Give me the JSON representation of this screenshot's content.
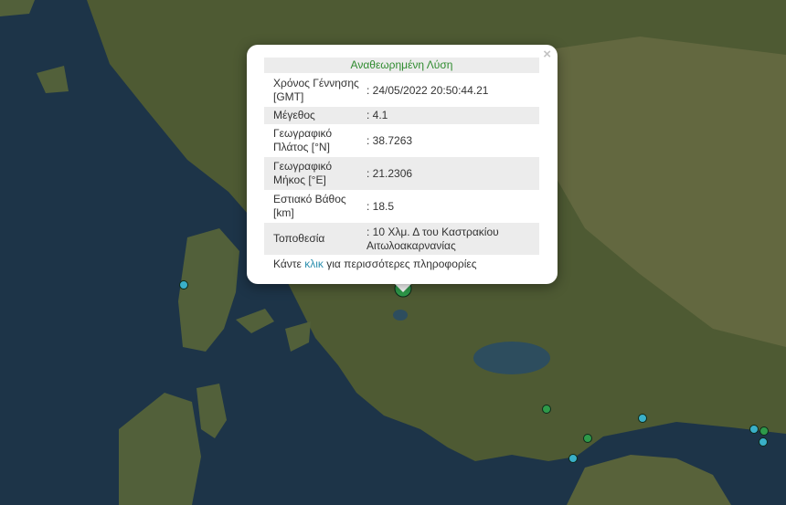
{
  "popup": {
    "close_label": "×",
    "title": "Αναθεωρημένη Λύση",
    "rows": [
      {
        "label": "Χρόνος Γέννησης [GMT]",
        "value": ": 24/05/2022 20:50:44.21"
      },
      {
        "label": "Μέγεθος",
        "value": ": 4.1"
      },
      {
        "label": "Γεωγραφικό Πλάτος [°N]",
        "value": ": 38.7263"
      },
      {
        "label": "Γεωγραφικό Μήκος [°E]",
        "value": ": 21.2306"
      },
      {
        "label": "Εστιακό Βάθος [km]",
        "value": ": 18.5"
      },
      {
        "label": "Τοποθεσία",
        "value": ": 10 Χλμ. Δ του Καστρακίου Αιτωλοακαρνανίας"
      }
    ],
    "footer_before": "Κάντε ",
    "footer_link": "κλικ",
    "footer_after": " για περισσότερες πληροφορίες"
  },
  "map": {
    "colors": {
      "sea": "#1d3448",
      "land": "#4e5a33",
      "land_light": "#6c6d46",
      "lake": "#2d4d5e"
    },
    "markers": [
      {
        "kind": "selected",
        "color": "#2e9a4a"
      },
      {
        "kind": "quake",
        "color": "#3ab0c8"
      },
      {
        "kind": "quake",
        "color": "#3ab0c8"
      },
      {
        "kind": "quake",
        "color": "#2e9a4a"
      },
      {
        "kind": "quake",
        "color": "#2e9a4a"
      },
      {
        "kind": "quake",
        "color": "#3ab0c8"
      },
      {
        "kind": "quake",
        "color": "#3ab0c8"
      },
      {
        "kind": "quake",
        "color": "#2e9a4a"
      },
      {
        "kind": "quake",
        "color": "#3ab0c8"
      }
    ]
  }
}
